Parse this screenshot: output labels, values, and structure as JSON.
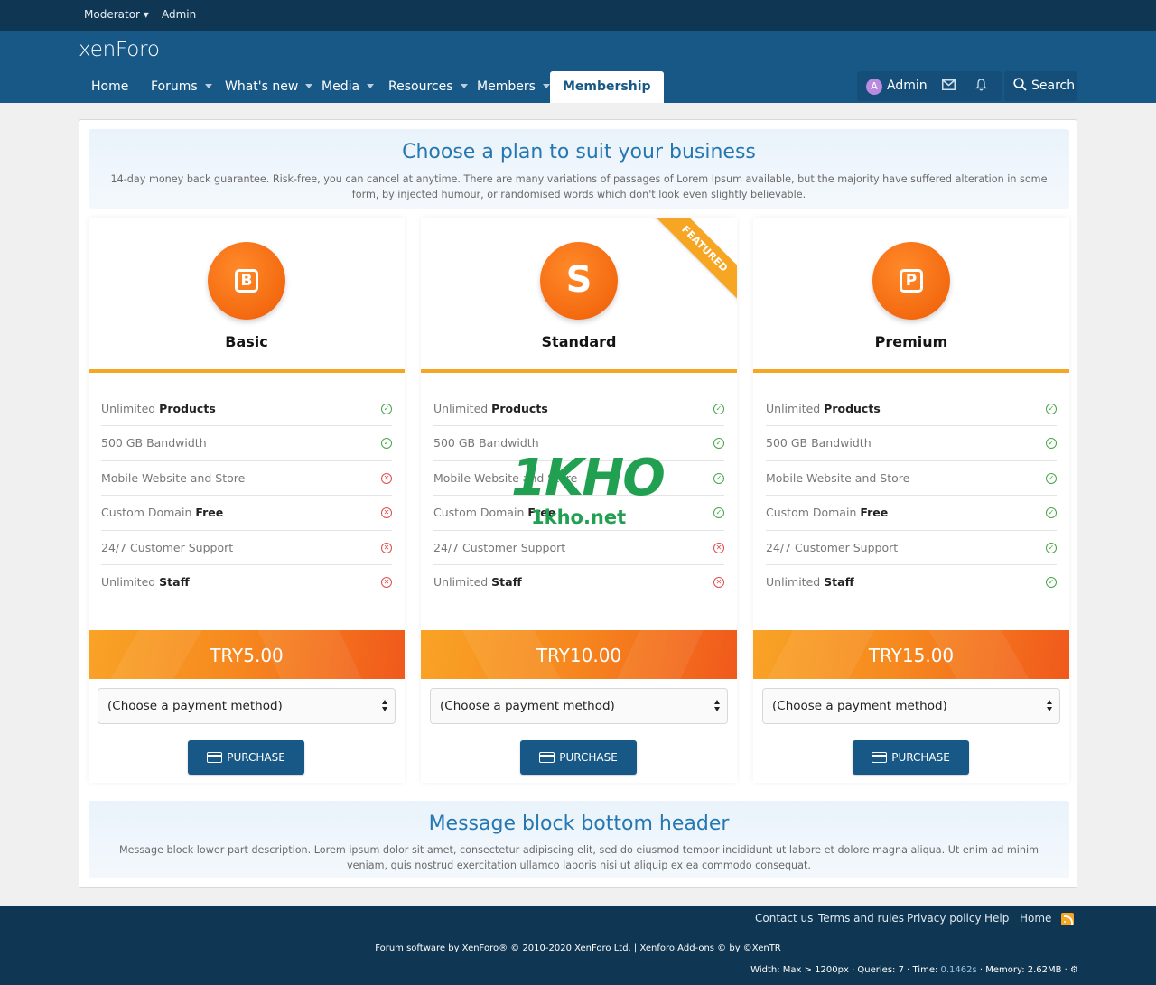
{
  "staffbar": {
    "moderator": "Moderator ▾",
    "admin": "Admin"
  },
  "header": {
    "logo_prefix": "xenF",
    "logo_o": "o",
    "logo_suffix": "ro",
    "nav": [
      {
        "label": "Home"
      },
      {
        "label": "Forums"
      },
      {
        "label": "What's new"
      },
      {
        "label": "Media"
      },
      {
        "label": "Resources"
      },
      {
        "label": "Members"
      },
      {
        "label": "Membership"
      }
    ],
    "user": {
      "avatar_letter": "A",
      "name": "Admin"
    },
    "search_label": "Search"
  },
  "top_block": {
    "title": "Choose a plan to suit your business",
    "description": "14-day money back guarantee. Risk-free, you can cancel at anytime. There are many variations of passages of Lorem Ipsum available, but the majority have suffered alteration in some form, by injected humour, or randomised words which don't look even slightly believable."
  },
  "plans": [
    {
      "name": "Basic",
      "letter": "B",
      "price": "TRY5.00",
      "featured": false,
      "features": [
        {
          "text": "Unlimited ",
          "bold": "Products",
          "available": true
        },
        {
          "text": "500 GB Bandwidth",
          "bold": "",
          "available": true
        },
        {
          "text": "Mobile Website and Store",
          "bold": "",
          "available": false
        },
        {
          "text": "Custom Domain ",
          "bold": "Free",
          "available": false
        },
        {
          "text": "24/7 Customer Support",
          "bold": "",
          "available": false
        },
        {
          "text": "Unlimited ",
          "bold": "Staff",
          "available": false
        }
      ]
    },
    {
      "name": "Standard",
      "letter": "S",
      "price": "TRY10.00",
      "featured": true,
      "ribbon": "FEATURED",
      "features": [
        {
          "text": "Unlimited ",
          "bold": "Products",
          "available": true
        },
        {
          "text": "500 GB Bandwidth",
          "bold": "",
          "available": true
        },
        {
          "text": "Mobile Website and Store",
          "bold": "",
          "available": true
        },
        {
          "text": "Custom Domain ",
          "bold": "Free",
          "available": true
        },
        {
          "text": "24/7 Customer Support",
          "bold": "",
          "available": false
        },
        {
          "text": "Unlimited ",
          "bold": "Staff",
          "available": false
        }
      ]
    },
    {
      "name": "Premium",
      "letter": "P",
      "price": "TRY15.00",
      "featured": false,
      "features": [
        {
          "text": "Unlimited ",
          "bold": "Products",
          "available": true
        },
        {
          "text": "500 GB Bandwidth",
          "bold": "",
          "available": true
        },
        {
          "text": "Mobile Website and Store",
          "bold": "",
          "available": true
        },
        {
          "text": "Custom Domain ",
          "bold": "Free",
          "available": true
        },
        {
          "text": "24/7 Customer Support",
          "bold": "",
          "available": true
        },
        {
          "text": "Unlimited ",
          "bold": "Staff",
          "available": true
        }
      ]
    }
  ],
  "payment_placeholder": "(Choose a payment method)",
  "purchase_label": "PURCHASE",
  "bottom_block": {
    "title": "Message block bottom header",
    "description": "Message block lower part description. Lorem ipsum dolor sit amet, consectetur adipiscing elit, sed do eiusmod tempor incididunt ut labore et dolore magna aliqua. Ut enim ad minim veniam, quis nostrud exercitation ullamco laboris nisi ut aliquip ex ea commodo consequat."
  },
  "watermark": {
    "main": "1KHO",
    "sub": "1kho.net"
  },
  "footer": {
    "links": [
      "Contact us",
      "Terms and rules",
      "Privacy policy",
      "Help",
      "Home"
    ],
    "copyright": "Forum software by XenForo® © 2010-2020 XenForo Ltd. | Xenforo Add-ons © by ©XenTR",
    "debug_prefix": "Width: Max > 1200px · Queries: 7 · Time: ",
    "debug_time": "0.1462s",
    "debug_suffix": " · Memory: 2.62MB · ⚙"
  },
  "colors": {
    "primary": "#185886",
    "dark": "#0f3652",
    "accent": "#f6a623",
    "yes": "#47a547",
    "no": "#e04b4b",
    "heading": "#2577b1"
  }
}
